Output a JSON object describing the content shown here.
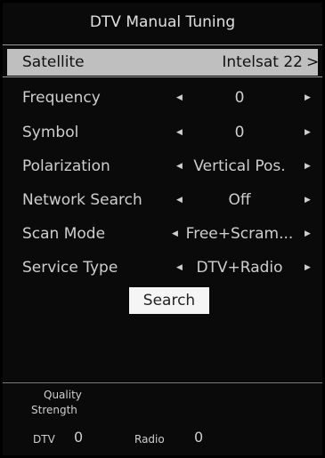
{
  "title": "DTV Manual Tuning",
  "rows": [
    {
      "label": "Satellite",
      "value": "Intelsat 22"
    },
    {
      "label": "Frequency",
      "value": "0"
    },
    {
      "label": "Symbol",
      "value": "0"
    },
    {
      "label": "Polarization",
      "value": "Vertical Pos."
    },
    {
      "label": "Network Search",
      "value": "Off"
    },
    {
      "label": "Scan Mode",
      "value": "Free+Scram..."
    },
    {
      "label": "Service Type",
      "value": "DTV+Radio"
    }
  ],
  "search_label": "Search",
  "signal": {
    "quality_label": "Quality",
    "strength_label": "Strength"
  },
  "counts": {
    "dtv_label": "DTV",
    "dtv_value": "0",
    "radio_label": "Radio",
    "radio_value": "0"
  },
  "icons": {
    "left": "triangle-left-icon",
    "right": "triangle-right-icon",
    "chevron": "chevron-right-icon"
  }
}
